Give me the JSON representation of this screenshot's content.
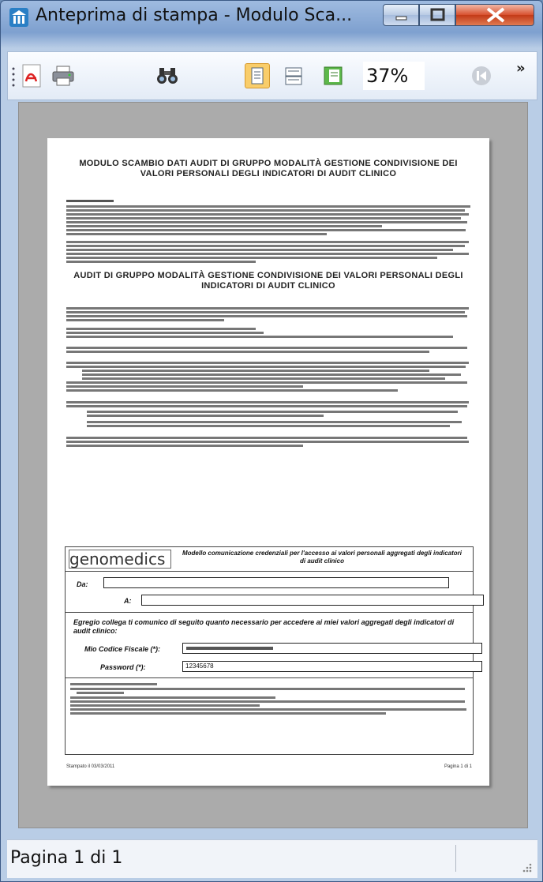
{
  "window": {
    "title": "Anteprima di stampa - Modulo Sca..."
  },
  "toolbar": {
    "zoom": "37%",
    "overflow_glyph": "»"
  },
  "statusbar": {
    "page_info": "Pagina 1 di 1"
  },
  "page": {
    "title": "MODULO SCAMBIO DATI AUDIT DI GRUPPO MODALITÀ GESTIONE CONDIVISIONE DEI VALORI PERSONALI DEGLI INDICATORI DI AUDIT CLINICO",
    "section_title": "AUDIT DI GRUPPO MODALITÀ GESTIONE CONDIVISIONE DEI VALORI PERSONALI DEGLI INDICATORI DI AUDIT CLINICO",
    "form": {
      "logo": "genomedics",
      "header": "Modello comunicazione credenziali per l'accesso ai valori personali aggregati degli indicatori di audit clinico",
      "da_label": "Da:",
      "a_label": "A:",
      "request_text": "Egregio collega ti comunico di seguito quanto necessario per accedere ai miei valori aggregati degli indicatori di audit clinico:",
      "cf_label": "Mio Codice Fiscale (*):",
      "password_label": "Password (*):",
      "password_value": "12345678"
    },
    "footer_left": "Stampato il 03/03/2011",
    "footer_right": "Pagina 1 di 1"
  },
  "colors": {
    "title_accent": "#1e4f8a",
    "highlight": "#f9cd6a"
  }
}
